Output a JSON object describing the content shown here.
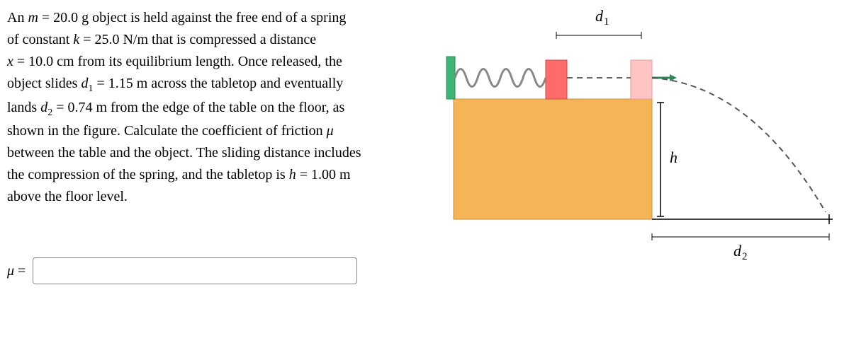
{
  "problem": {
    "line1_a": "An ",
    "line1_b": " = 20.0 g object is held against the free end of a spring",
    "line2_a": "of constant ",
    "line2_b": " = 25.0 N/m that is compressed a distance",
    "line3_a": "",
    "line3_b": " = 10.0 cm from its equilibrium length. Once released, the",
    "line4_a": "object slides ",
    "line4_b": " = 1.15 m across the tabletop and eventually",
    "line5_a": "lands ",
    "line5_b": " = 0.74 m from the edge of the table on the floor, as",
    "line6": "shown in the figure. Calculate the coefficient of friction ",
    "line7": "between the table and the object. The sliding distance includes",
    "line8_a": "the compression of the spring, and the tabletop is ",
    "line8_b": " = 1.00 m",
    "line9": "above the floor level."
  },
  "vars": {
    "m": "m",
    "k": "k",
    "x": "x",
    "d1_a": "d",
    "d1_b": "1",
    "d2_a": "d",
    "d2_b": "2",
    "mu": "μ",
    "h": "h"
  },
  "answer": {
    "label_a": "μ",
    "label_b": " ="
  },
  "diagram_labels": {
    "d1": "d",
    "d1_sub": "1",
    "d2": "d",
    "d2_sub": "2",
    "h": "h"
  }
}
